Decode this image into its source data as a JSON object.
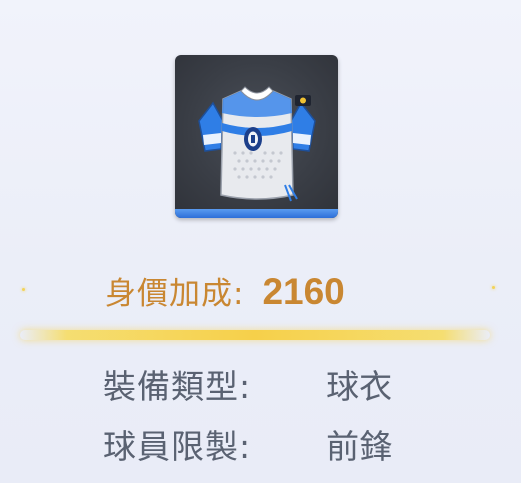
{
  "item": {
    "icon": "jersey-icon",
    "rarity_color": "#2d6fd8"
  },
  "stats": {
    "bonus_label": "身價加成:",
    "bonus_value": "2160",
    "equip_type_label": "裝備類型:",
    "equip_type_value": "球衣",
    "player_restriction_label": "球員限製:",
    "player_restriction_value": "前鋒"
  },
  "colors": {
    "bonus_text": "#c98732",
    "info_text": "#5a6272",
    "divider_glow": "#f6d04a"
  }
}
